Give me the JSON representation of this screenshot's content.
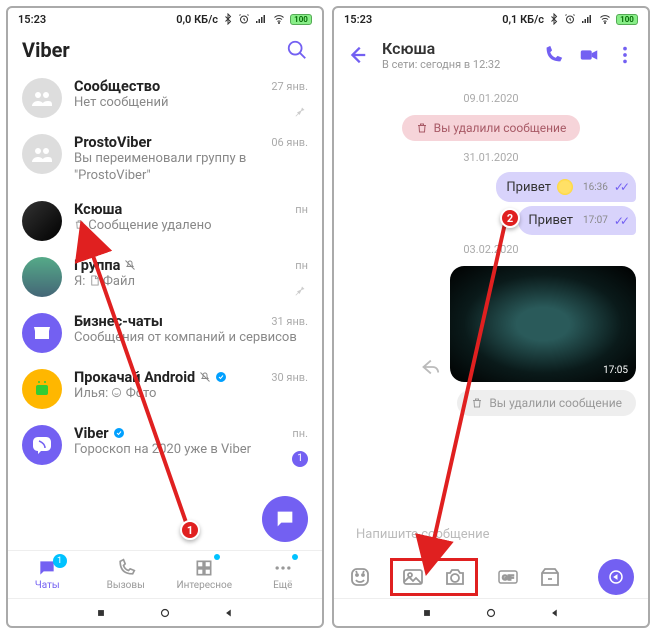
{
  "left": {
    "status": {
      "time": "15:23",
      "net": "0,0 КБ/с",
      "battery": "100"
    },
    "header": {
      "title": "Viber"
    },
    "chats": [
      {
        "name": "Сообщество",
        "sub": "Нет сообщений",
        "date": "27 янв.",
        "pinned": true
      },
      {
        "name": "ProstoViber",
        "sub": "Вы переименовали группу в \"ProstoViber\"",
        "date": "06 янв."
      },
      {
        "name": "Ксюша",
        "sub": "Сообщение удалено",
        "subicon": "trash",
        "date": "пн"
      },
      {
        "name": "Группа",
        "sub": "Я: Файл",
        "subicon": "file",
        "date": "пн",
        "pinned": true,
        "muted": true
      },
      {
        "name": "Бизнес-чаты",
        "sub": "Сообщения от компаний и сервисов",
        "date": "31 янв."
      },
      {
        "name": "Прокачай Android",
        "sub": "Илья: Фото",
        "subicon": "photo",
        "date": "30 янв.",
        "verified": true,
        "muted": true
      },
      {
        "name": "Viber",
        "sub": "Гороскоп на 2020 уже в Viber",
        "date": "пн.",
        "verified": true,
        "unread": 1
      }
    ],
    "tabs": [
      {
        "label": "Чаты",
        "badge": "1"
      },
      {
        "label": "Вызовы"
      },
      {
        "label": "Интересное",
        "dot": true
      },
      {
        "label": "Ещё",
        "dot": true
      }
    ],
    "step": "1"
  },
  "right": {
    "status": {
      "time": "15:23",
      "net": "0,1 КБ/с",
      "battery": "100"
    },
    "header": {
      "name": "Ксюша",
      "status": "В сети: сегодня в 12:32"
    },
    "dates": {
      "d1": "09.01.2020",
      "d2": "31.01.2020",
      "d3": "03.02.2020"
    },
    "deleted": "Вы удалили сообщение",
    "msgs": {
      "m1": "Привет",
      "t1": "16:36",
      "m2": "Привет",
      "t2": "17:07",
      "t3": "17:05"
    },
    "input": {
      "placeholder": "Напишите сообщение"
    },
    "step": "2"
  }
}
